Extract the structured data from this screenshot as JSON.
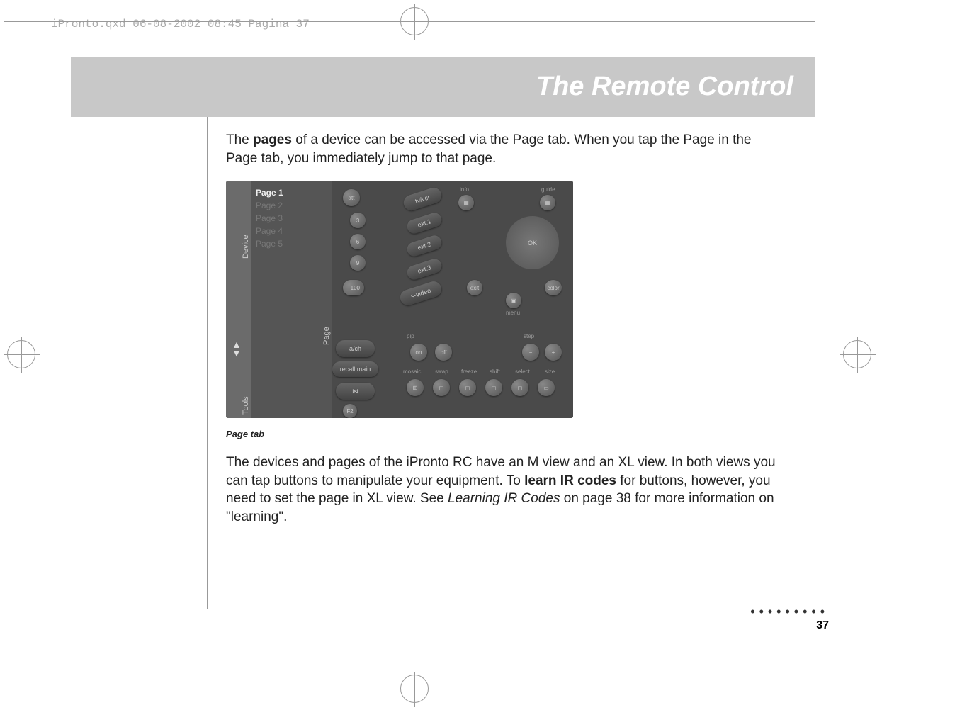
{
  "meta": {
    "fileinfo": "iPronto.qxd  06-08-2002  08:45  Pagina 37"
  },
  "title": "The Remote Control",
  "para1_prefix": "The ",
  "para1_bold": "pages",
  "para1_rest": " of a device can be accessed via the Page tab. When you tap the Page in the Page tab, you immediately jump to that page.",
  "figure": {
    "sidebar": {
      "device": "Device",
      "page": "Page",
      "tools": "Tools"
    },
    "pagelist": {
      "p1": "Page 1",
      "p2": "Page 2",
      "p3": "Page 3",
      "p4": "Page 4",
      "p5": "Page 5"
    },
    "buttons": {
      "att": "att",
      "n3": "3",
      "n6": "6",
      "n9": "9",
      "p100": "+100",
      "arch": "a/ch",
      "recall": "recall main",
      "bowtieicon": "⋈",
      "f2": "F2",
      "tvvcr": "tv/vcr",
      "ext1": "ext.1",
      "ext2": "ext.2",
      "ext3": "ext.3",
      "svideo": "s-video",
      "info": "info",
      "guide": "guide",
      "ok": "OK",
      "exit": "exit",
      "menu": "menu",
      "color": "color",
      "pip": "pip",
      "on": "on",
      "off": "off",
      "step": "step",
      "minus": "−",
      "plus": "+",
      "mosaic": "mosaic",
      "swap": "swap",
      "freeze": "freeze",
      "shift": "shift",
      "select": "select",
      "size": "size"
    }
  },
  "caption": "Page tab",
  "para2_a": "The devices and pages of the iPronto RC have an M view and an XL view. In both views you can tap buttons to manipulate your equipment. To ",
  "para2_bold": "learn IR codes",
  "para2_b": " for buttons, however, you need to set the page in XL view. See ",
  "para2_italic": "Learning IR Codes",
  "para2_c": " on page 38 for more information on \"learning\".",
  "pagenum": "37",
  "dots": "•••••••••"
}
